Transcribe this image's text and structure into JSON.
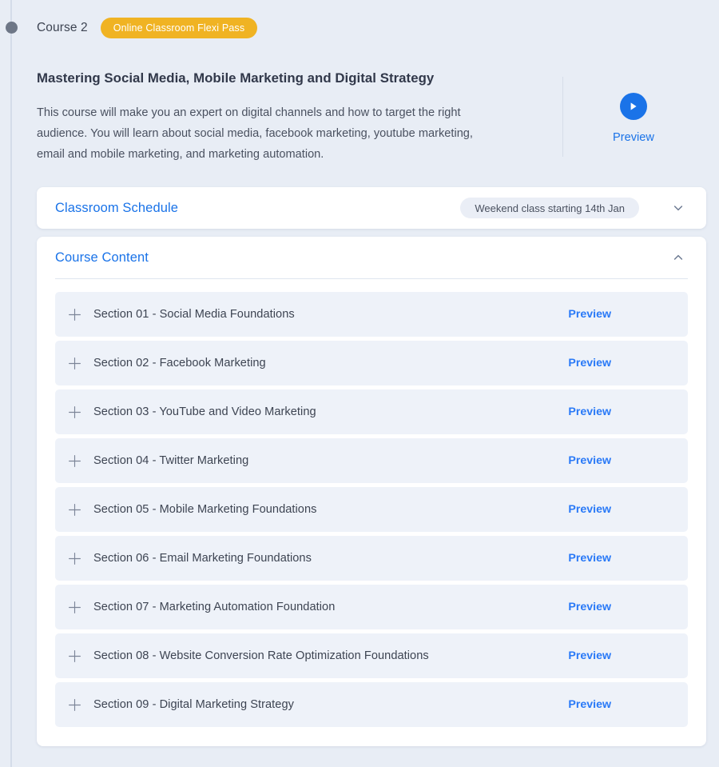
{
  "timeline": {
    "dot_color": "#6e7787",
    "line_color": "#d4dce9"
  },
  "header": {
    "course_label": "Course 2",
    "badge_label": "Online Classroom Flexi Pass",
    "badge_color": "#f0b323",
    "title": "Mastering Social Media, Mobile Marketing and Digital Strategy",
    "description": "This course will make you an expert on digital channels and how to target the right audience. You will learn about social media, facebook marketing, youtube marketing, email and mobile marketing, and marketing automation."
  },
  "preview_cta": {
    "icon": "play-icon",
    "label": "Preview",
    "accent_color": "#1a73e8"
  },
  "schedule_panel": {
    "title": "Classroom Schedule",
    "pill_label": "Weekend class starting 14th Jan",
    "chevron": "chevron-down-icon",
    "expanded": false
  },
  "content_panel": {
    "title": "Course Content",
    "chevron": "chevron-up-icon",
    "expanded": true,
    "preview_label": "Preview",
    "expand_icon": "plus-icon",
    "sections": [
      {
        "title": "Section 01 - Social Media Foundations"
      },
      {
        "title": "Section 02 - Facebook Marketing"
      },
      {
        "title": "Section 03 - YouTube and Video Marketing"
      },
      {
        "title": "Section 04 - Twitter Marketing"
      },
      {
        "title": "Section 05 - Mobile Marketing Foundations"
      },
      {
        "title": "Section 06 - Email Marketing Foundations"
      },
      {
        "title": "Section 07 - Marketing Automation Foundation"
      },
      {
        "title": "Section 08 - Website Conversion Rate Optimization Foundations"
      },
      {
        "title": "Section 09 - Digital Marketing Strategy"
      }
    ]
  }
}
